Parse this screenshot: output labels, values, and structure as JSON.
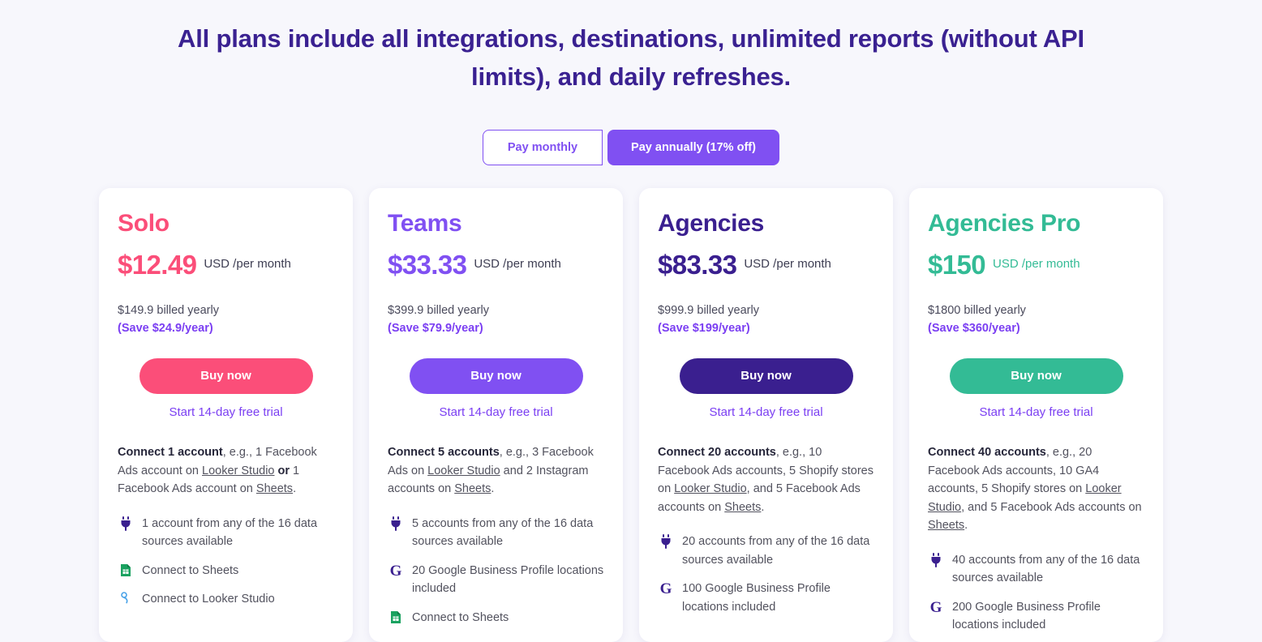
{
  "headline": "All plans include all integrations, destinations, unlimited reports (without API limits), and daily refreshes.",
  "billing_toggle": {
    "monthly_label": "Pay monthly",
    "annual_label": "Pay annually (17% off)",
    "selected": "annual",
    "accent_color": "#8050f2"
  },
  "plans": [
    {
      "name": "Solo",
      "color": "#fb4e79",
      "price": "$12.49",
      "price_unit": "USD /per month",
      "price_unit_colored": false,
      "billed": "$149.9 billed yearly",
      "save": "(Save $24.9/year)",
      "buy_label": "Buy now",
      "trial_label": "Start 14-day free trial",
      "desc_bold": "Connect 1 account",
      "desc_parts": [
        {
          "t": ", e.g., 1 Facebook Ads account on ",
          "u": false
        },
        {
          "t": "Looker Studio",
          "u": true
        },
        {
          "t": " ",
          "u": false
        },
        {
          "t": "or",
          "u": false,
          "b": true
        },
        {
          "t": " 1 Facebook Ads account on ",
          "u": false
        },
        {
          "t": "Sheets",
          "u": true
        },
        {
          "t": ".",
          "u": false
        }
      ],
      "features": [
        {
          "icon": "plug-icon",
          "text": "1 account from any of the 16 data sources available"
        },
        {
          "icon": "sheets-icon",
          "text": "Connect to Sheets"
        },
        {
          "icon": "looker-studio-icon",
          "text": "Connect to Looker Studio"
        }
      ]
    },
    {
      "name": "Teams",
      "color": "#8050f2",
      "price": "$33.33",
      "price_unit": "USD /per month",
      "price_unit_colored": false,
      "billed": "$399.9 billed yearly",
      "save": "(Save $79.9/year)",
      "buy_label": "Buy now",
      "trial_label": "Start 14-day free trial",
      "desc_bold": "Connect 5 accounts",
      "desc_parts": [
        {
          "t": ", e.g., 3 Facebook Ads on ",
          "u": false
        },
        {
          "t": "Looker Studio",
          "u": true
        },
        {
          "t": " and 2 Instagram accounts on ",
          "u": false
        },
        {
          "t": "Sheets",
          "u": true
        },
        {
          "t": ".",
          "u": false
        }
      ],
      "features": [
        {
          "icon": "plug-icon",
          "text": "5 accounts from any of the 16 data sources available"
        },
        {
          "icon": "google-icon",
          "text": "20 Google Business Profile locations included"
        },
        {
          "icon": "sheets-icon",
          "text": "Connect to Sheets"
        }
      ]
    },
    {
      "name": "Agencies",
      "color": "#3a1f8f",
      "price": "$83.33",
      "price_unit": "USD /per month",
      "price_unit_colored": false,
      "billed": "$999.9 billed yearly",
      "save": "(Save $199/year)",
      "buy_label": "Buy now",
      "trial_label": "Start 14-day free trial",
      "desc_bold": "Connect 20 accounts",
      "desc_parts": [
        {
          "t": ", e.g., 10 Facebook Ads accounts, 5 Shopify stores on ",
          "u": false
        },
        {
          "t": "Looker Studio",
          "u": true
        },
        {
          "t": ", and 5 Facebook Ads accounts on ",
          "u": false
        },
        {
          "t": "Sheets",
          "u": true
        },
        {
          "t": ".",
          "u": false
        }
      ],
      "features": [
        {
          "icon": "plug-icon",
          "text": "20 accounts from any of the 16 data sources available"
        },
        {
          "icon": "google-icon",
          "text": "100 Google Business Profile locations included"
        }
      ]
    },
    {
      "name": "Agencies Pro",
      "color": "#33bb95",
      "price": "$150",
      "price_unit": "USD /per month",
      "price_unit_colored": true,
      "billed": "$1800 billed yearly",
      "save": "(Save $360/year)",
      "buy_label": "Buy now",
      "trial_label": "Start 14-day free trial",
      "desc_bold": "Connect 40 accounts",
      "desc_parts": [
        {
          "t": ", e.g., 20 Facebook Ads accounts, 10 GA4 accounts,  5 Shopify stores on ",
          "u": false
        },
        {
          "t": "Looker Studio",
          "u": true
        },
        {
          "t": ", and 5 Facebook Ads accounts on ",
          "u": false
        },
        {
          "t": "Sheets",
          "u": true
        },
        {
          "t": ".",
          "u": false
        }
      ],
      "features": [
        {
          "icon": "plug-icon",
          "text": "40 accounts from any of the 16 data sources available"
        },
        {
          "icon": "google-icon",
          "text": "200 Google Business Profile locations included"
        }
      ]
    }
  ]
}
